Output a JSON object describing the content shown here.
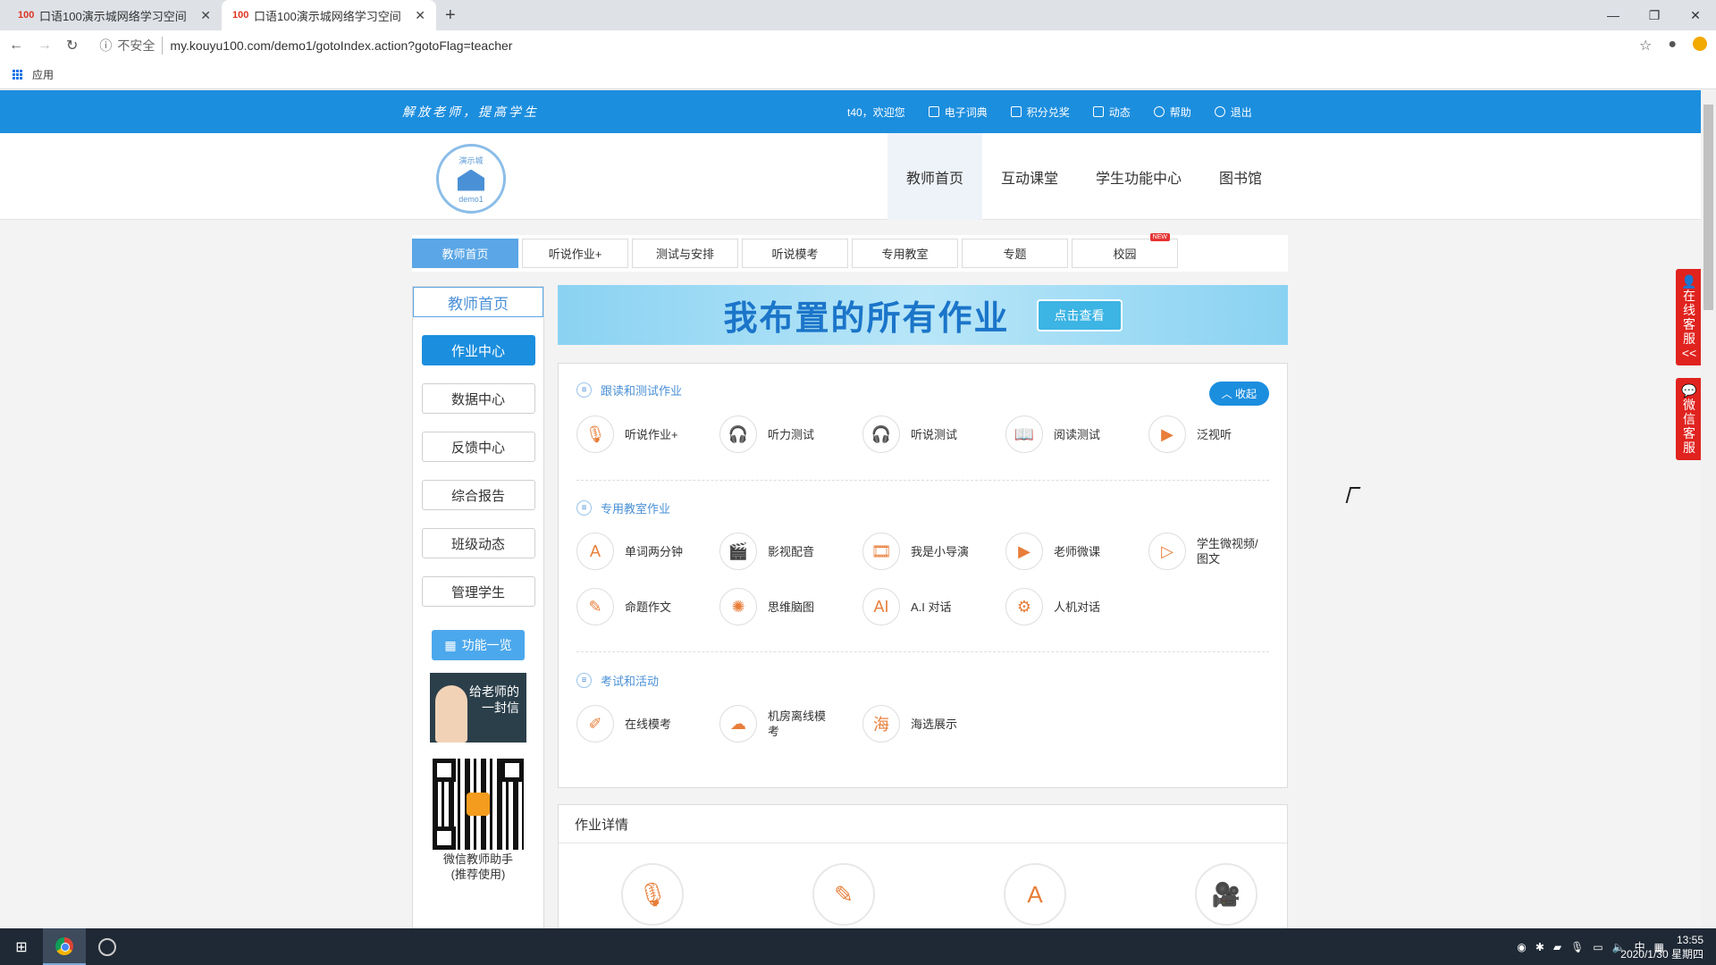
{
  "browser": {
    "tabs": [
      {
        "favicon": "100",
        "title": "口语100演示城网络学习空间",
        "close": "✕"
      },
      {
        "favicon": "100",
        "title": "口语100演示城网络学习空间",
        "close": "✕"
      }
    ],
    "new_tab": "+",
    "window_controls": [
      "—",
      "❐",
      "✕"
    ],
    "security_label": "不安全",
    "url": "my.kouyu100.com/demo1/gotoIndex.action?gotoFlag=teacher",
    "bookmarks_apps": "应用"
  },
  "site": {
    "slogan": "解放老师，提高学生",
    "welcome": "t40，欢迎您",
    "top_links": [
      "电子词典",
      "积分兑奖",
      "动态",
      "帮助",
      "退出"
    ],
    "logo_text_top": "演示城",
    "logo_text_bottom": "demo1",
    "main_nav": [
      "教师首页",
      "互动课堂",
      "学生功能中心",
      "图书馆"
    ],
    "sub_tabs": [
      "教师首页",
      "听说作业+",
      "测试与安排",
      "听说模考",
      "专用教室",
      "专题",
      "校园"
    ],
    "new_badge": "NEW"
  },
  "sidebar": {
    "title": "教师首页",
    "buttons": [
      "作业中心",
      "数据中心",
      "反馈中心",
      "综合报告",
      "班级动态",
      "管理学生"
    ],
    "func_button": "功能一览",
    "letter": "给老师的一封信",
    "qr_caption": "微信教师助手\n(推荐使用)"
  },
  "banner": {
    "title": "我布置的所有作业",
    "button": "点击查看"
  },
  "homework": {
    "collapse": "收起",
    "section1": {
      "title": "跟读和测试作业",
      "items": [
        "听说作业+",
        "听力测试",
        "听说测试",
        "阅读测试",
        "泛视听"
      ]
    },
    "section2": {
      "title": "专用教室作业",
      "items_row1": [
        "单词两分钟",
        "影视配音",
        "我是小导演",
        "老师微课",
        "学生微视频/图文"
      ],
      "items_row2": [
        "命题作文",
        "思维脑图",
        "A.I 对话",
        "人机对话"
      ]
    },
    "section3": {
      "title": "考试和活动",
      "items": [
        "在线模考",
        "机房离线模考",
        "海选展示"
      ]
    }
  },
  "details": {
    "title": "作业详情"
  },
  "right_services": [
    "在线客服",
    "微信客服"
  ],
  "taskbar": {
    "time": "13:55",
    "date": "2020/1/30 星期四",
    "ime": "中"
  },
  "colors": {
    "brand_blue": "#1c8ede",
    "accent_orange": "#e87e3a",
    "service_red": "#e0231f"
  }
}
